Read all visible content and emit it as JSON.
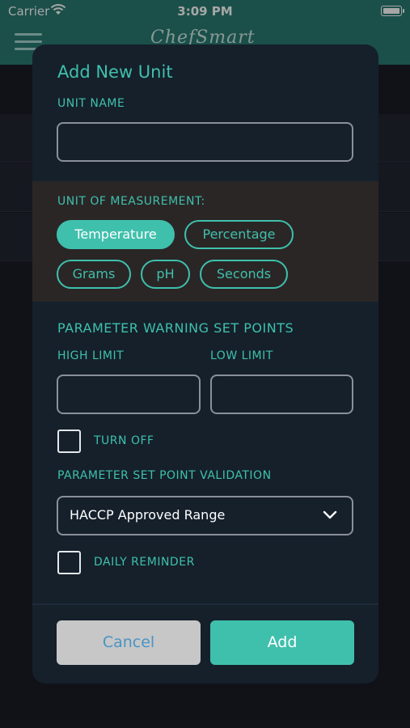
{
  "status_bar": {
    "carrier": "Carrier",
    "time": "3:09 PM"
  },
  "app": {
    "logo_text": "ChefSmart"
  },
  "icons": {
    "menu": "hamburger-menu-icon",
    "wifi": "wifi-icon",
    "battery": "battery-icon",
    "chevron": "chevron-down-icon"
  },
  "modal": {
    "title": "Add New Unit",
    "unit_name": {
      "label": "UNIT NAME",
      "value": "",
      "placeholder": ""
    },
    "unit_of_measurement": {
      "label": "UNIT OF MEASUREMENT:",
      "options": [
        "Temperature",
        "Percentage",
        "Grams",
        "pH",
        "Seconds"
      ],
      "selected": "Temperature"
    },
    "warning_set_points": {
      "heading": "PARAMETER WARNING SET POINTS",
      "high_limit": {
        "label": "HIGH LIMIT",
        "value": ""
      },
      "low_limit": {
        "label": "LOW LIMIT",
        "value": ""
      },
      "turn_off": {
        "label": "TURN OFF",
        "checked": false
      }
    },
    "validation": {
      "label": "PARAMETER SET POINT VALIDATION",
      "selected": "HACCP Approved Range"
    },
    "daily_reminder": {
      "label": "DAILY REMINDER",
      "checked": false
    },
    "buttons": {
      "cancel": "Cancel",
      "add": "Add"
    }
  },
  "colors": {
    "accent": "#3fc0ac",
    "modal_bg": "#15202b",
    "band_bg": "#2a2626",
    "cancel_bg": "#c7c7c7",
    "cancel_text": "#4a94c4"
  }
}
